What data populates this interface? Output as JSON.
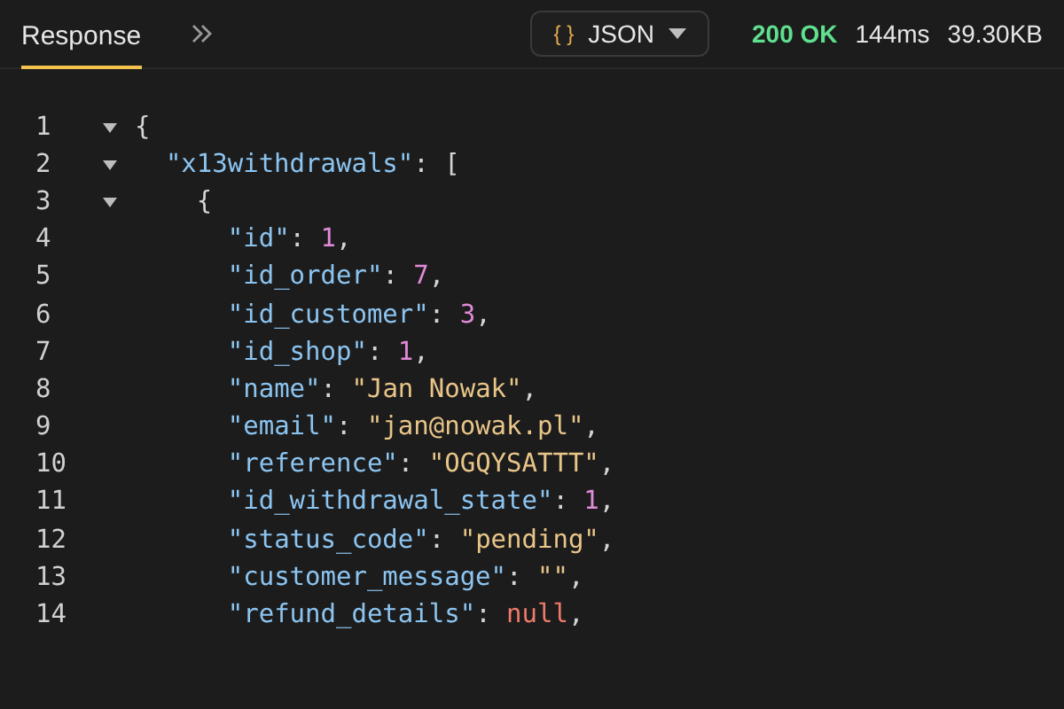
{
  "tabs": [
    {
      "label": "Response",
      "selected": true
    }
  ],
  "format_dropdown": {
    "icon_text": "{ }",
    "label": "JSON"
  },
  "status": {
    "code": "200 OK",
    "time": "144ms",
    "size": "39.30KB"
  },
  "code_lines": [
    {
      "number": "1",
      "expanded": true,
      "tokens": [
        {
          "kind": "punct",
          "text": "{"
        }
      ],
      "children": [
        {
          "number": "2",
          "expanded": true,
          "tokens": [
            {
              "kind": "key",
              "text": "\"x13withdrawals\""
            },
            {
              "kind": "punct",
              "text": ": ["
            }
          ],
          "children": [
            {
              "number": "3",
              "expanded": true,
              "tokens": [
                {
                  "kind": "punct",
                  "text": "{"
                }
              ],
              "children": [
                {
                  "number": "4",
                  "tokens": [
                    {
                      "kind": "key",
                      "text": "\"id\""
                    },
                    {
                      "kind": "punct",
                      "text": ": "
                    },
                    {
                      "kind": "number",
                      "text": "1"
                    },
                    {
                      "kind": "punct",
                      "text": ","
                    }
                  ]
                },
                {
                  "number": "5",
                  "tokens": [
                    {
                      "kind": "key",
                      "text": "\"id_order\""
                    },
                    {
                      "kind": "punct",
                      "text": ": "
                    },
                    {
                      "kind": "number",
                      "text": "7"
                    },
                    {
                      "kind": "punct",
                      "text": ","
                    }
                  ]
                },
                {
                  "number": "6",
                  "tokens": [
                    {
                      "kind": "key",
                      "text": "\"id_customer\""
                    },
                    {
                      "kind": "punct",
                      "text": ": "
                    },
                    {
                      "kind": "number",
                      "text": "3"
                    },
                    {
                      "kind": "punct",
                      "text": ","
                    }
                  ]
                },
                {
                  "number": "7",
                  "tokens": [
                    {
                      "kind": "key",
                      "text": "\"id_shop\""
                    },
                    {
                      "kind": "punct",
                      "text": ": "
                    },
                    {
                      "kind": "number",
                      "text": "1"
                    },
                    {
                      "kind": "punct",
                      "text": ","
                    }
                  ]
                },
                {
                  "number": "8",
                  "tokens": [
                    {
                      "kind": "key",
                      "text": "\"name\""
                    },
                    {
                      "kind": "punct",
                      "text": ": "
                    },
                    {
                      "kind": "string",
                      "text": "\"Jan Nowak\""
                    },
                    {
                      "kind": "punct",
                      "text": ","
                    }
                  ]
                },
                {
                  "number": "9",
                  "tokens": [
                    {
                      "kind": "key",
                      "text": "\"email\""
                    },
                    {
                      "kind": "punct",
                      "text": ": "
                    },
                    {
                      "kind": "string",
                      "text": "\"jan@nowak.pl\""
                    },
                    {
                      "kind": "punct",
                      "text": ","
                    }
                  ]
                },
                {
                  "number": "10",
                  "tokens": [
                    {
                      "kind": "key",
                      "text": "\"reference\""
                    },
                    {
                      "kind": "punct",
                      "text": ": "
                    },
                    {
                      "kind": "string",
                      "text": "\"OGQYSATTT\""
                    },
                    {
                      "kind": "punct",
                      "text": ","
                    }
                  ]
                },
                {
                  "number": "11",
                  "tokens": [
                    {
                      "kind": "key",
                      "text": "\"id_withdrawal_state\""
                    },
                    {
                      "kind": "punct",
                      "text": ": "
                    },
                    {
                      "kind": "number",
                      "text": "1"
                    },
                    {
                      "kind": "punct",
                      "text": ","
                    }
                  ]
                },
                {
                  "number": "12",
                  "tokens": [
                    {
                      "kind": "key",
                      "text": "\"status_code\""
                    },
                    {
                      "kind": "punct",
                      "text": ": "
                    },
                    {
                      "kind": "string",
                      "text": "\"pending\""
                    },
                    {
                      "kind": "punct",
                      "text": ","
                    }
                  ]
                },
                {
                  "number": "13",
                  "tokens": [
                    {
                      "kind": "key",
                      "text": "\"customer_message\""
                    },
                    {
                      "kind": "punct",
                      "text": ": "
                    },
                    {
                      "kind": "string",
                      "text": "\"\""
                    },
                    {
                      "kind": "punct",
                      "text": ","
                    }
                  ]
                },
                {
                  "number": "14",
                  "tokens": [
                    {
                      "kind": "key",
                      "text": "\"refund_details\""
                    },
                    {
                      "kind": "punct",
                      "text": ": "
                    },
                    {
                      "kind": "null",
                      "text": "null"
                    },
                    {
                      "kind": "punct",
                      "text": ","
                    }
                  ]
                }
              ]
            }
          ]
        }
      ]
    }
  ]
}
